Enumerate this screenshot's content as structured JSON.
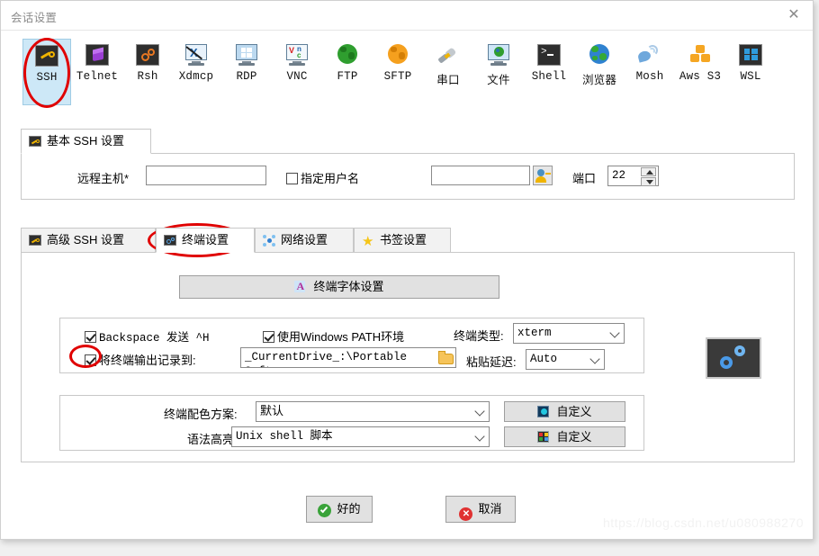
{
  "window": {
    "title": "会话设置",
    "close_label": "✕"
  },
  "protocols": [
    {
      "label": "SSH",
      "icon": "key-icon",
      "selected": true
    },
    {
      "label": "Telnet",
      "icon": "cube-icon",
      "selected": false
    },
    {
      "label": "Rsh",
      "icon": "gears-icon",
      "selected": false
    },
    {
      "label": "Xdmcp",
      "icon": "xdmcp-icon",
      "selected": false
    },
    {
      "label": "RDP",
      "icon": "windows-monitor-icon",
      "selected": false
    },
    {
      "label": "VNC",
      "icon": "vnc-monitor-icon",
      "selected": false
    },
    {
      "label": "FTP",
      "icon": "green-globe-icon",
      "selected": false
    },
    {
      "label": "SFTP",
      "icon": "orange-globe-icon",
      "selected": false
    },
    {
      "label": "串口",
      "icon": "serial-plug-icon",
      "selected": false
    },
    {
      "label": "文件",
      "icon": "file-monitor-icon",
      "selected": false
    },
    {
      "label": "Shell",
      "icon": "shell-prompt-icon",
      "selected": false
    },
    {
      "label": "浏览器",
      "icon": "browser-globe-icon",
      "selected": false
    },
    {
      "label": "Mosh",
      "icon": "satellite-icon",
      "selected": false
    },
    {
      "label": "Aws S3",
      "icon": "aws-cubes-icon",
      "selected": false
    },
    {
      "label": "WSL",
      "icon": "windows-logo-icon",
      "selected": false
    }
  ],
  "basic_tab": {
    "label": "基本 SSH 设置",
    "icon": "key-icon",
    "remote_host_label": "远程主机*",
    "remote_host_value": "",
    "specify_user_label": "指定用户名",
    "specify_user_checked": false,
    "username_value": "",
    "user_icon": "user-key-icon",
    "port_label": "端口",
    "port_value": "22"
  },
  "settings_tabs": [
    {
      "label": "高级 SSH 设置",
      "icon": "key-icon",
      "active": false
    },
    {
      "label": "终端设置",
      "icon": "gears-icon",
      "active": true
    },
    {
      "label": "网络设置",
      "icon": "network-icon",
      "active": false
    },
    {
      "label": "书签设置",
      "icon": "star-icon",
      "active": false
    }
  ],
  "terminal": {
    "font_button_label": "终端字体设置",
    "font_button_icon": "font-a-icon",
    "backspace_label": "Backspace 发送 ^H",
    "backspace_checked": true,
    "windows_path_label": "使用Windows PATH环境",
    "windows_path_checked": true,
    "log_label": "将终端输出记录到:",
    "log_checked": true,
    "log_path_value": "_CurrentDrive_:\\Portable Softwa",
    "folder_icon": "folder-icon",
    "terminal_type_label": "终端类型:",
    "terminal_type_value": "xterm",
    "paste_delay_label": "粘贴延迟:",
    "paste_delay_value": "Auto",
    "gears_panel_icon": "gears-icon"
  },
  "colors": {
    "scheme_label": "终端配色方案:",
    "scheme_value": "默认",
    "scheme_custom_label": "自定义",
    "scheme_custom_icon": "palette-icon",
    "syntax_label": "语法高亮:",
    "syntax_value": "Unix shell 脚本",
    "syntax_custom_label": "自定义",
    "syntax_custom_icon": "syntax-colors-icon"
  },
  "footer": {
    "ok_label": "好的",
    "ok_icon": "check-circle-icon",
    "cancel_label": "取消",
    "cancel_icon": "x-circle-icon",
    "watermark": "https://blog.csdn.net/u080988270"
  },
  "theme": {
    "accent": "#cde8f7",
    "annotation_red": "#e00000",
    "ok_green": "#3aa33a",
    "cancel_red": "#e03131"
  }
}
